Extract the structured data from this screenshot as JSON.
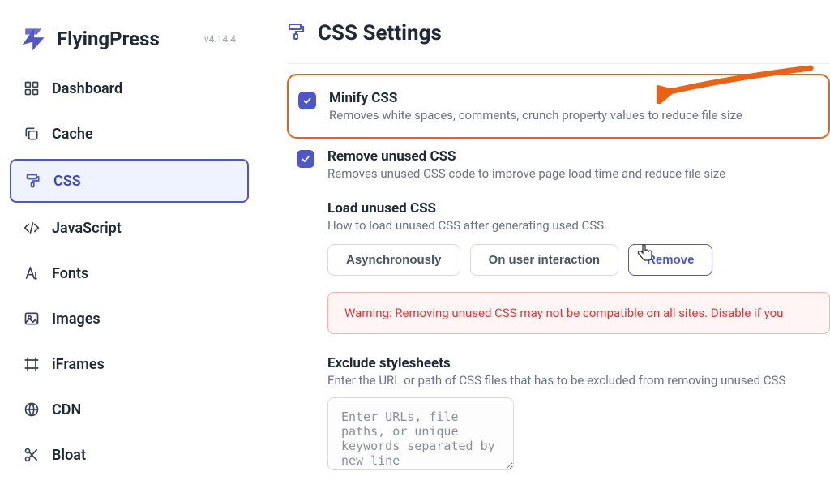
{
  "brand": {
    "name": "FlyingPress",
    "version": "v4.14.4"
  },
  "sidebar": {
    "items": [
      {
        "label": "Dashboard"
      },
      {
        "label": "Cache"
      },
      {
        "label": "CSS"
      },
      {
        "label": "JavaScript"
      },
      {
        "label": "Fonts"
      },
      {
        "label": "Images"
      },
      {
        "label": "iFrames"
      },
      {
        "label": "CDN"
      },
      {
        "label": "Bloat"
      }
    ],
    "active_index": 2
  },
  "page": {
    "title": "CSS Settings",
    "settings": {
      "minify": {
        "title": "Minify CSS",
        "desc": "Removes white spaces, comments, crunch property values to reduce file size",
        "checked": true
      },
      "remove_unused": {
        "title": "Remove unused CSS",
        "desc": "Removes unused CSS code to improve page load time and reduce file size",
        "checked": true
      },
      "load_unused": {
        "title": "Load unused CSS",
        "desc": "How to load unused CSS after generating used CSS",
        "options": [
          "Asynchronously",
          "On user interaction",
          "Remove"
        ],
        "selected_index": 2
      },
      "warning": "Warning: Removing unused CSS may not be compatible on all sites. Disable if you",
      "exclude": {
        "title": "Exclude stylesheets",
        "desc": "Enter the URL or path of CSS files that has to be excluded from removing unused CSS",
        "placeholder": "Enter URLs, file paths, or unique keywords separated by new line"
      }
    }
  }
}
